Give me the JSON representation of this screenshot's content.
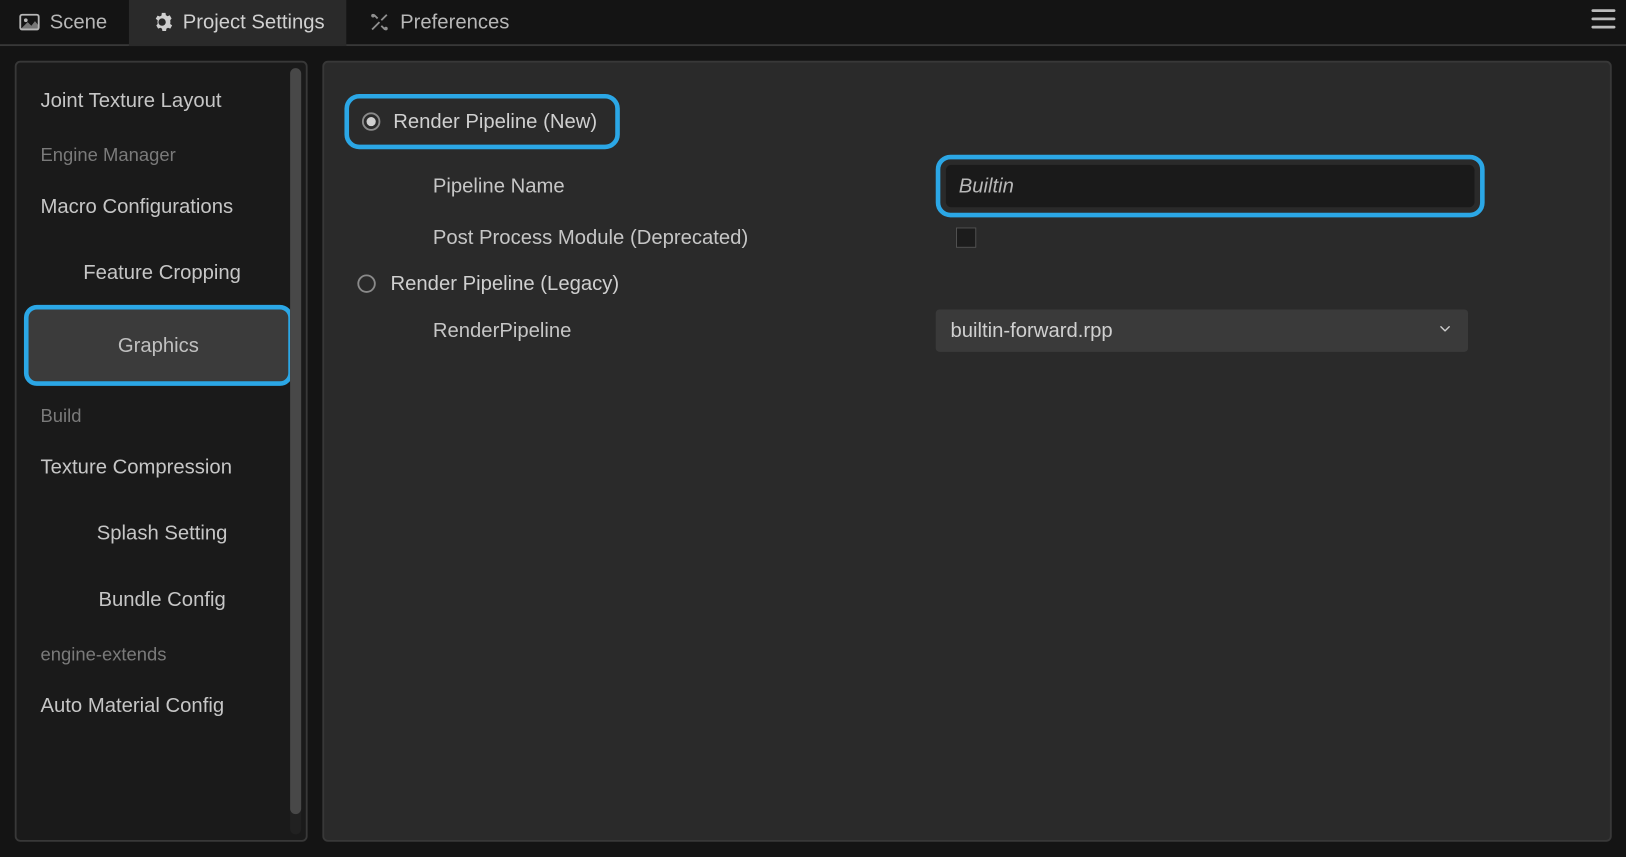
{
  "tabs": {
    "scene": "Scene",
    "project_settings": "Project Settings",
    "preferences": "Preferences"
  },
  "sidebar": {
    "items": {
      "joint_texture_layout": "Joint Texture Layout",
      "macro_configurations": "Macro Configurations",
      "feature_cropping": "Feature Cropping",
      "graphics": "Graphics",
      "texture_compression": "Texture Compression",
      "splash_setting": "Splash Setting",
      "bundle_config": "Bundle Config",
      "auto_material_config": "Auto Material Config"
    },
    "headers": {
      "engine_manager": "Engine Manager",
      "build": "Build",
      "engine_extends": "engine-extends"
    }
  },
  "content": {
    "radio_new": "Render Pipeline (New)",
    "pipeline_name": "Pipeline Name",
    "pipeline_name_value": "Builtin",
    "post_process": "Post Process Module (Deprecated)",
    "radio_legacy": "Render Pipeline (Legacy)",
    "render_pipeline": "RenderPipeline",
    "render_pipeline_value": "builtin-forward.rpp"
  }
}
